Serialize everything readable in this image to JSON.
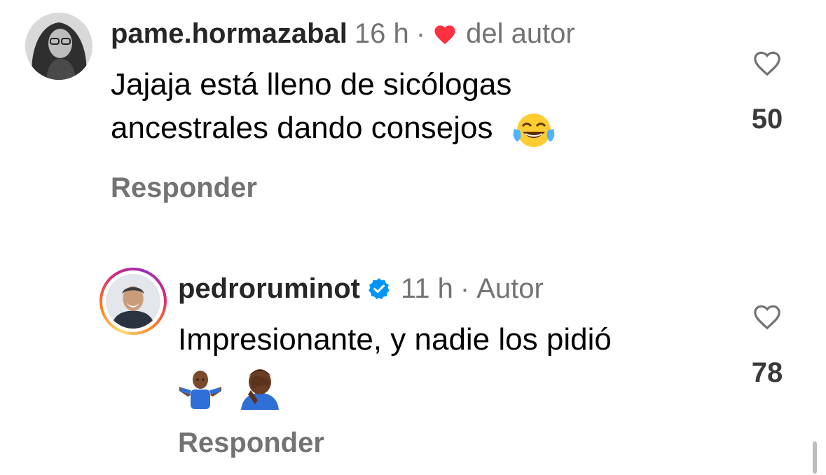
{
  "comments": [
    {
      "username": "pame.hormazabal",
      "time": "16 h",
      "separator": "·",
      "author_tag": "del autor",
      "liked_by_author": true,
      "text_line1": "Jajaja está lleno de sicólogas",
      "text_line2": "ancestrales dando consejos",
      "emojis": [
        "face-with-tears-of-joy"
      ],
      "reply_label": "Responder",
      "likes": "50"
    },
    {
      "username": "pedroruminot",
      "verified": true,
      "has_story": true,
      "time": "11 h",
      "separator": "·",
      "author_tag": "Autor",
      "text_line1": "Impresionante, y nadie los pidió",
      "emojis": [
        "person-shrugging",
        "person-facepalming"
      ],
      "reply_label": "Responder",
      "likes": "78"
    }
  ],
  "colors": {
    "heart_red": "#ff3040",
    "verified_blue": "#0095f6",
    "secondary_text": "#737373"
  }
}
